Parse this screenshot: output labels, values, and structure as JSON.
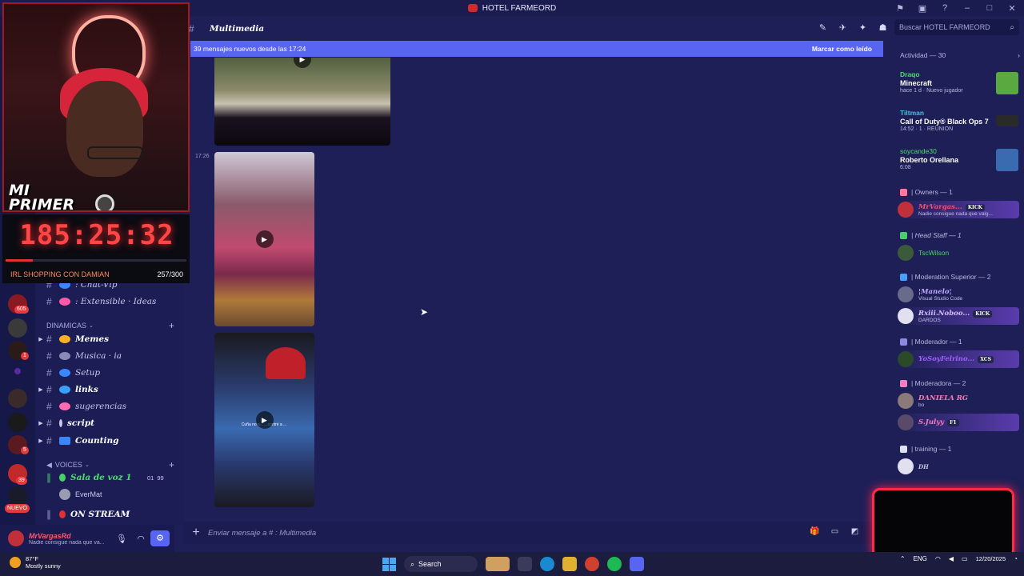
{
  "window": {
    "title": "HOTEL FARMEORD"
  },
  "stream_overlay": {
    "banner": "MI PRIMER CARRO",
    "timer": "185:25:32",
    "progress_fraction": 0.15,
    "goal_label": "IRL SHOPPING CON DAMIAN",
    "goal_count": "257/300"
  },
  "channels": {
    "items": [
      {
        "label": ": Chat-Vip",
        "color": "#3a86ff",
        "bold": false
      },
      {
        "label": ": Extensible · Ideas",
        "color": "#ff5aa8",
        "bold": false
      }
    ],
    "category_dinamicas": "DINAMICAS",
    "dinamicas": [
      {
        "label": "Memes",
        "color": "#ffb020",
        "bold": true
      },
      {
        "label": "Musica · ia",
        "color": "#8a8ab8",
        "bold": false
      },
      {
        "label": "Setup",
        "color": "#3a86ff",
        "bold": false
      },
      {
        "label": "links",
        "color": "#3aa0ff",
        "bold": true
      },
      {
        "label": "sugerencias",
        "color": "#ff6ab0",
        "bold": false
      },
      {
        "label": "script",
        "color": "#c8c8e8",
        "bold": true
      },
      {
        "label": "Counting",
        "color": "#3a86ff",
        "bold": true
      }
    ],
    "category_voices": "VOICES",
    "voice_channel": "Sala de voz 1",
    "voice_user": "EverMat",
    "voice_count_left": "01",
    "voice_count_right": "99",
    "stream_channel": "ON STREAM"
  },
  "server_badges": [
    "605",
    "1",
    "5",
    "39"
  ],
  "server_new_label": "NUEVO",
  "user_panel": {
    "name": "MrVargasRd",
    "status": "Nadie consigue nada que va..."
  },
  "header": {
    "channel_name": "Multimedia"
  },
  "search": {
    "placeholder": "Buscar HOTEL FARMEORD"
  },
  "new_messages": {
    "text": "39 mensajes nuevos desde las 17:24",
    "mark_read": "Marcar como leído"
  },
  "messages": {
    "timestamp": "17:26",
    "video_caption": "Cuña no n... ...contré a ..."
  },
  "composer": {
    "placeholder": "Enviar mensaje a # : Multimedia"
  },
  "members": {
    "activity_header": "Actividad — 30",
    "activities": [
      {
        "name": "Draqo",
        "game": "Minecraft",
        "meta": "hace 1 d · Nuevo jugador",
        "art_color": "#5aa840"
      },
      {
        "name": "Tiltman",
        "game": "Call of Duty® Black Ops 7",
        "meta": "14:52 · 1 · REUNION",
        "art_color": "#2a2a2a"
      },
      {
        "name": "soycande30",
        "game": "Roberto Orellana",
        "meta": "6:08",
        "art_color": "#3a6ab0"
      }
    ],
    "groups": [
      {
        "label": "| Owners — 1"
      },
      {
        "label": "| Head Staff — 1"
      },
      {
        "label": "| Moderation Superior — 2"
      },
      {
        "label": "| Moderador — 1"
      },
      {
        "label": "| Moderadora — 2"
      },
      {
        "label": "| training — 1"
      }
    ],
    "owners": [
      {
        "name": "MrVargas...",
        "sub": "Nadie consigue nada que valg...",
        "tag": "KICK",
        "color": "#ff4a6a"
      }
    ],
    "head_staff": [
      {
        "name": "TscWilson",
        "color": "#48d06a"
      }
    ],
    "mod_superior": [
      {
        "name": "¦Manelo¦",
        "sub": "Visual Studio Code",
        "color": "#c0a8ff"
      },
      {
        "name": "Rxiii.Noboo...",
        "sub": "DARDOS",
        "tag": "KICK",
        "color": "#d0c0ff"
      }
    ],
    "moderador": [
      {
        "name": "YoSoyFelrino...",
        "tag": "XCS",
        "color": "#a060ff"
      }
    ],
    "moderadora": [
      {
        "name": "DANIELA RG",
        "sub": "bo",
        "color": "#ff7ab0"
      },
      {
        "name": "S.Julyy",
        "tag": "F1",
        "color": "#ff7ac0"
      }
    ],
    "training": [
      {
        "name": "DH",
        "color": "#c8c8e8"
      }
    ]
  },
  "taskbar": {
    "temp": "87°F",
    "weather": "Mostly sunny",
    "search": "Search",
    "lang": "ENG",
    "date": "12/20/2025"
  }
}
